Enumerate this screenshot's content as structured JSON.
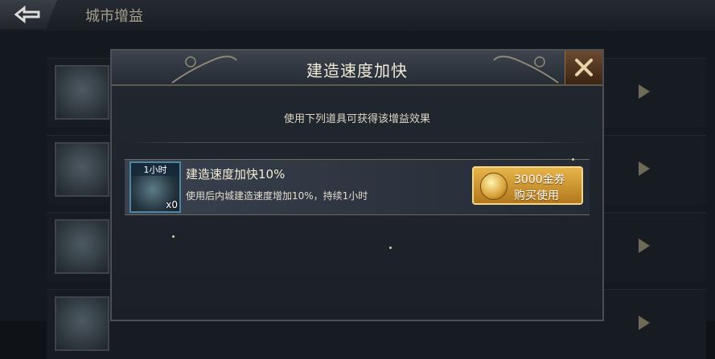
{
  "header": {
    "title": "城市增益"
  },
  "dialog": {
    "title": "建造速度加快",
    "subtitle": "使用下列道具可获得该增益效果",
    "item": {
      "icon_tag": "1小时",
      "count": "x0",
      "name": "建造速度加快10%",
      "description": "使用后内城建造速度增加10%，持续1小时",
      "price": "3000金券",
      "buy_label": "购买使用"
    }
  },
  "colors": {
    "accent_gold": "#d9a23a",
    "panel_bg": "#1f252d"
  },
  "icons": [
    "back-arrow-icon",
    "close-x-icon",
    "scroll-coin-icon",
    "right-arrow-icon"
  ]
}
